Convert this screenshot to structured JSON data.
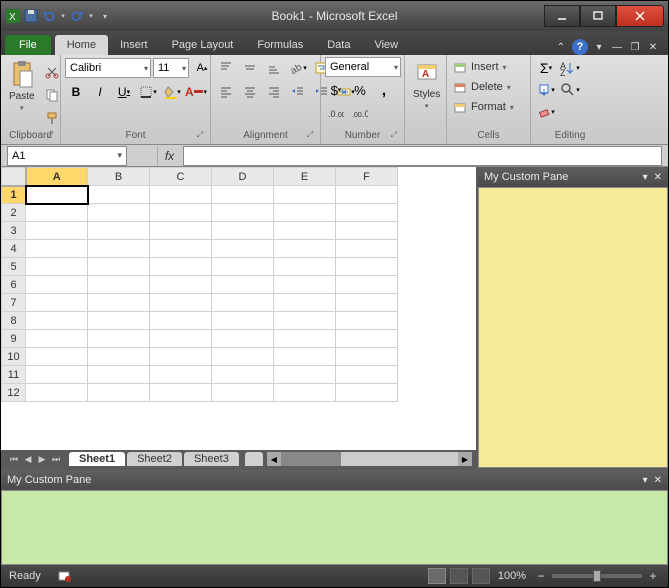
{
  "window": {
    "title": "Book1 - Microsoft Excel"
  },
  "qat": {
    "save": "save",
    "undo": "undo",
    "redo": "redo"
  },
  "tabs": {
    "file": "File",
    "items": [
      "Home",
      "Insert",
      "Page Layout",
      "Formulas",
      "Data",
      "View"
    ],
    "active": "Home"
  },
  "ribbon": {
    "clipboard": {
      "label": "Clipboard",
      "paste": "Paste"
    },
    "font": {
      "label": "Font",
      "family": "Calibri",
      "size": "11",
      "bold": "B",
      "italic": "I",
      "underline": "U"
    },
    "alignment": {
      "label": "Alignment"
    },
    "number": {
      "label": "Number",
      "format": "General"
    },
    "styles": {
      "label": "Styles",
      "btn": "Styles"
    },
    "cells": {
      "label": "Cells",
      "insert": "Insert",
      "delete": "Delete",
      "format": "Format"
    },
    "editing": {
      "label": "Editing"
    }
  },
  "formula_bar": {
    "name_box": "A1",
    "fx": "fx"
  },
  "grid": {
    "cols": [
      "A",
      "B",
      "C",
      "D",
      "E",
      "F"
    ],
    "rows": [
      "1",
      "2",
      "3",
      "4",
      "5",
      "6",
      "7",
      "8",
      "9",
      "10",
      "11",
      "12"
    ],
    "selected": "A1"
  },
  "sheets": {
    "items": [
      "Sheet1",
      "Sheet2",
      "Sheet3"
    ],
    "active": "Sheet1"
  },
  "panes": {
    "right": {
      "title": "My Custom Pane",
      "color": "#f5eb9a"
    },
    "bottom": {
      "title": "My Custom Pane",
      "color": "#c8e8a8"
    }
  },
  "status": {
    "ready": "Ready",
    "zoom": "100%"
  }
}
